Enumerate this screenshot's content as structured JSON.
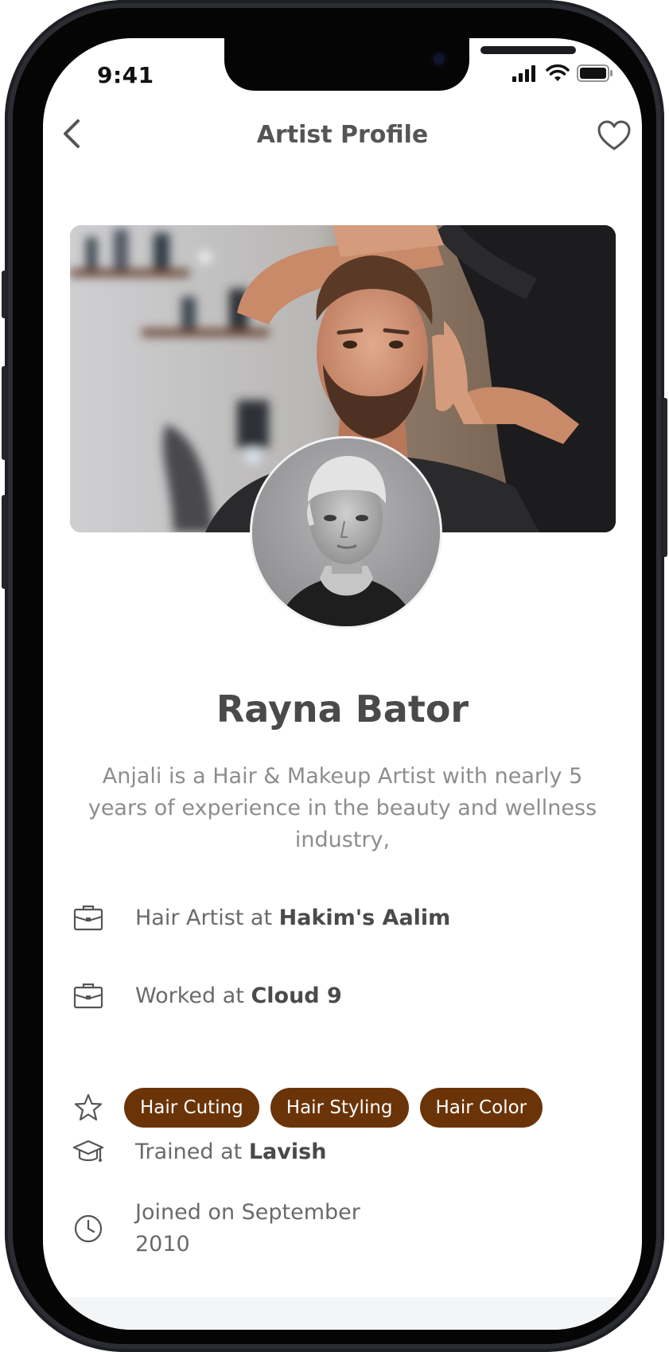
{
  "status_bar": {
    "time": "9:41"
  },
  "header": {
    "title": "Artist Profile"
  },
  "profile": {
    "name": "Rayna Bator",
    "bio": "Anjali is a Hair & Makeup Artist with nearly 5 years of experience in the beauty and wellness industry,"
  },
  "details": {
    "current_job": {
      "prefix": "Hair Artist at ",
      "place": "Hakim's Aalim"
    },
    "previous_job": {
      "prefix": "Worked at ",
      "place": "Cloud 9"
    },
    "skills": [
      "Hair Cuting",
      "Hair Styling",
      "Hair Color"
    ],
    "training": {
      "prefix": "Trained at ",
      "place": "Lavish"
    },
    "joined": {
      "line1": "Joined on September",
      "line2": "2010"
    }
  },
  "colors": {
    "accent": "#6B3408",
    "title_text": "#555555",
    "body_text": "#8D8D8D"
  },
  "icons": {
    "back": "chevron-left-icon",
    "favorite": "heart-icon",
    "job": "briefcase-icon",
    "skills": "star-icon",
    "training": "graduation-cap-icon",
    "joined": "clock-icon"
  }
}
